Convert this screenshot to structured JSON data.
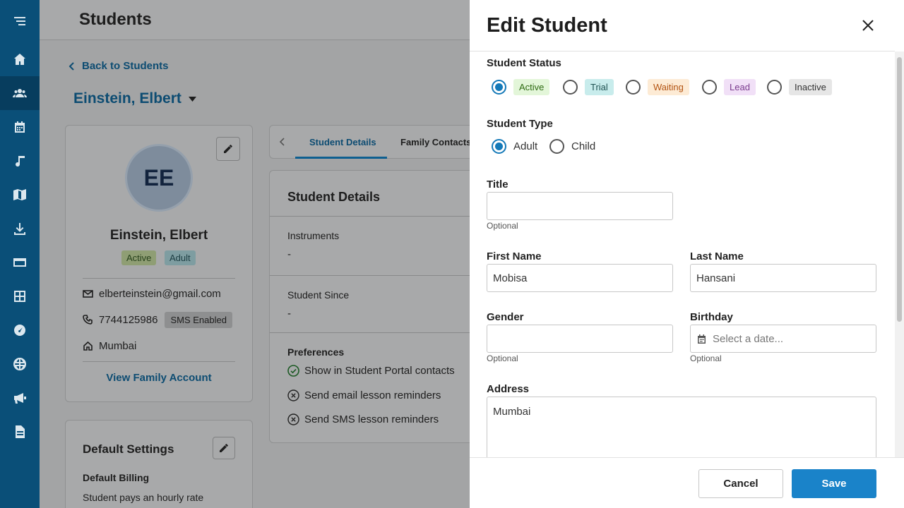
{
  "app": {
    "page_title": "Students",
    "back_link": "Back to Students",
    "student_name": "Einstein, Elbert"
  },
  "sidebar": {
    "items": [
      "logo-icon",
      "home-icon",
      "users-icon",
      "calendar-icon",
      "music-icon",
      "book-map-icon",
      "download-icon",
      "card-icon",
      "calculator-icon",
      "dashboard-icon",
      "globe-icon",
      "megaphone-icon",
      "document-icon"
    ]
  },
  "profile": {
    "initials": "EE",
    "name": "Einstein, Elbert",
    "badges": [
      "Active",
      "Adult"
    ],
    "email": "elberteinstein@gmail.com",
    "phone": "7744125986",
    "sms_badge": "SMS Enabled",
    "city": "Mumbai",
    "family_link": "View Family Account"
  },
  "tabs": {
    "items": [
      "Student Details",
      "Family Contacts"
    ],
    "active": "Student Details"
  },
  "details": {
    "title": "Student Details",
    "instruments_label": "Instruments",
    "instruments_value": "-",
    "since_label": "Student Since",
    "since_value": "-",
    "prefs_label": "Preferences",
    "prefs": [
      {
        "text": "Show in Student Portal contacts",
        "enabled": true
      },
      {
        "text": "Send email lesson reminders",
        "enabled": false
      },
      {
        "text": "Send SMS lesson reminders",
        "enabled": false
      }
    ]
  },
  "defaults": {
    "title": "Default Settings",
    "billing_label": "Default Billing",
    "billing_value": "Student pays an hourly rate"
  },
  "drawer": {
    "title": "Edit Student",
    "status_label": "Student Status",
    "statuses": [
      "Active",
      "Trial",
      "Waiting",
      "Lead",
      "Inactive"
    ],
    "status_selected": "Active",
    "type_label": "Student Type",
    "types": [
      "Adult",
      "Child"
    ],
    "type_selected": "Adult",
    "title_label": "Title",
    "title_value": "",
    "title_help": "Optional",
    "first_label": "First Name",
    "first_value": "Mobisa",
    "last_label": "Last Name",
    "last_value": "Hansani",
    "gender_label": "Gender",
    "gender_value": "",
    "gender_help": "Optional",
    "birthday_label": "Birthday",
    "birthday_placeholder": "Select a date...",
    "birthday_help": "Optional",
    "address_label": "Address",
    "address_value": "Mumbai",
    "cancel_label": "Cancel",
    "save_label": "Save"
  },
  "colors": {
    "sidebar": "#0a4f78",
    "accent": "#1479b8",
    "save": "#1a83c9"
  }
}
